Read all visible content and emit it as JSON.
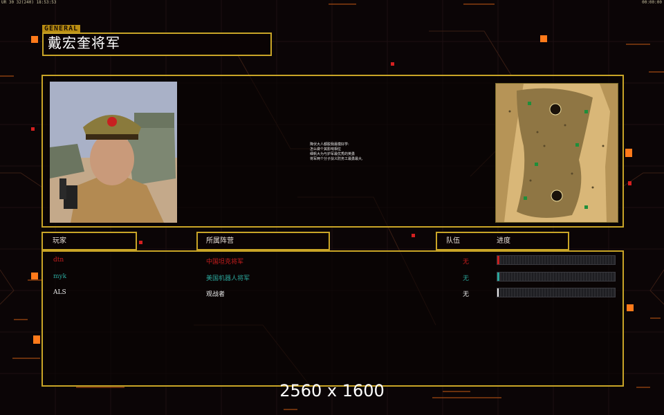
{
  "status_bar": {
    "left_text": "UR 30 32(240) 18:53:53",
    "right_text": "00:00:00"
  },
  "header": {
    "tag": "GENERAL",
    "general_name": "戴宏奎将军"
  },
  "briefing": {
    "lines": [
      "降伏大人都脱我最模好学:",
      "怎么做个其影响相位",
      "细帆大为与护军最优秀的英勇",
      "将军两个分子扶义防务工最勇最大,"
    ]
  },
  "columns": {
    "player": "玩家",
    "faction": "所属阵营",
    "team": "队伍",
    "progress": "进度"
  },
  "players": [
    {
      "name": "dtn",
      "faction": "中国坦克将军",
      "team": "无",
      "color": "#c81e1e",
      "progress": 0.02
    },
    {
      "name": "myk",
      "faction": "美国机器人将军",
      "team": "无",
      "color": "#2aa59a",
      "progress": 0.02
    },
    {
      "name": "ALS",
      "faction": "观战者",
      "team": "无",
      "color": "#e8e8e8",
      "progress": 0.01
    }
  ],
  "resolution_label": "2560 x 1600",
  "colors": {
    "accent_gold": "#c9a527",
    "accent_orange": "#ff7a1a",
    "background": "#0b0506"
  }
}
